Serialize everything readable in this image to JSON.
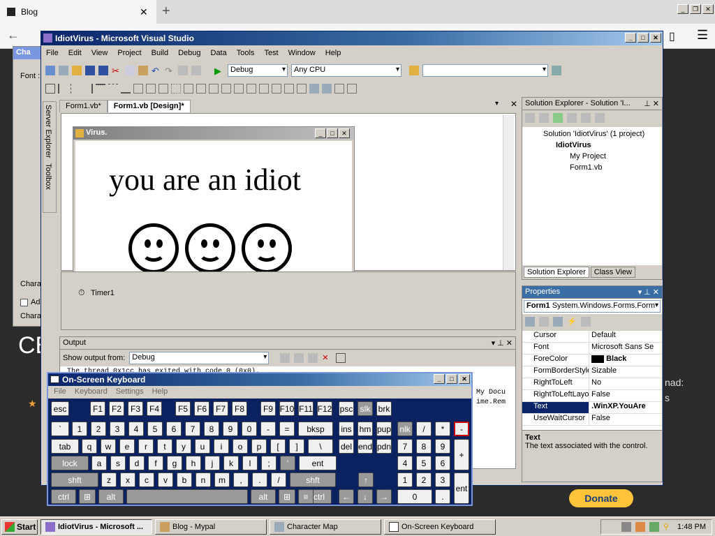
{
  "browser": {
    "tab_title": "Blog",
    "side_texts": [
      "CE",
      "nad:",
      "s"
    ]
  },
  "charmap": {
    "title": "Cha",
    "font_label": "Font :",
    "chars_label": "Chara",
    "advanced_label": "Ad",
    "chars_label2": "Chara"
  },
  "donate": "Donate",
  "vs": {
    "title": "IdiotVirus - Microsoft Visual Studio",
    "menu": [
      "File",
      "Edit",
      "View",
      "Project",
      "Build",
      "Debug",
      "Data",
      "Tools",
      "Test",
      "Window",
      "Help"
    ],
    "config": "Debug",
    "platform": "Any CPU",
    "side_tabs": [
      "Server Explorer",
      "Toolbox"
    ],
    "doc_tabs": [
      "Form1.vb*",
      "Form1.vb [Design]*"
    ],
    "form": {
      "title": "Virus.",
      "text": "you are an idiot"
    },
    "timer": "Timer1",
    "output": {
      "title": "Output",
      "show_from_label": "Show output from:",
      "show_from_value": "Debug",
      "line1": "The thread 0x1cc has exited with code 0 (0x0).",
      "right_text1": "My Docu",
      "right_text2": "ime.Rem"
    },
    "solution_explorer": {
      "title": "Solution Explorer - Solution 'I...",
      "items": [
        "Solution 'IdiotVirus' (1 project)",
        "IdiotVirus",
        "My Project",
        "Form1.vb"
      ],
      "tab1": "Solution Explorer",
      "tab2": "Class View"
    },
    "properties": {
      "title": "Properties",
      "object_name": "Form1",
      "object_type": "System.Windows.Forms.Form",
      "rows": [
        {
          "name": "Cursor",
          "value": "Default"
        },
        {
          "name": "Font",
          "value": "Microsoft Sans Se"
        },
        {
          "name": "ForeColor",
          "value": "Black"
        },
        {
          "name": "FormBorderStyle",
          "value": "Sizable"
        },
        {
          "name": "RightToLeft",
          "value": "No"
        },
        {
          "name": "RightToLeftLayo",
          "value": "False"
        },
        {
          "name": "Text",
          "value": ".WinXP.YouAre"
        },
        {
          "name": "UseWaitCursor",
          "value": "False"
        }
      ],
      "desc_title": "Text",
      "desc_text": "The text associated with the control."
    }
  },
  "osk": {
    "title": "On-Screen Keyboard",
    "menu": [
      "File",
      "Keyboard",
      "Settings",
      "Help"
    ],
    "keys": {
      "r0": [
        "esc",
        "F1",
        "F2",
        "F3",
        "F4",
        "F5",
        "F6",
        "F7",
        "F8",
        "F9",
        "F10",
        "F11",
        "F12",
        "psc",
        "slk",
        "brk"
      ],
      "r1": [
        "`",
        "1",
        "2",
        "3",
        "4",
        "5",
        "6",
        "7",
        "8",
        "9",
        "0",
        "-",
        "=",
        "bksp",
        "ins",
        "hm",
        "pup",
        "nlk",
        "/",
        "*",
        "-"
      ],
      "r2": [
        "tab",
        "q",
        "w",
        "e",
        "r",
        "t",
        "y",
        "u",
        "i",
        "o",
        "p",
        "[",
        "]",
        "\\",
        "del",
        "end",
        "pdn",
        "7",
        "8",
        "9",
        "+"
      ],
      "r3": [
        "lock",
        "a",
        "s",
        "d",
        "f",
        "g",
        "h",
        "j",
        "k",
        "l",
        ";",
        "'",
        "ent",
        "4",
        "5",
        "6"
      ],
      "r4": [
        "shft",
        "z",
        "x",
        "c",
        "v",
        "b",
        "n",
        "m",
        ",",
        ".",
        "/",
        "shft",
        "1",
        "2",
        "3",
        "ent"
      ],
      "r5": [
        "ctrl",
        "alt",
        "alt",
        "ctrl",
        "0",
        "."
      ]
    }
  },
  "taskbar": {
    "start": "Start",
    "tasks": [
      "IdiotVirus - Microsoft ...",
      "Blog - Mypal",
      "Character Map",
      "On-Screen Keyboard"
    ],
    "time": "1:48 PM"
  }
}
